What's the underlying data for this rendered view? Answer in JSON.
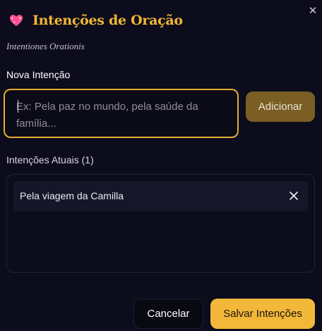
{
  "dialog": {
    "title": "Intenções de Oração",
    "subtitle": "Intentiones Orationis",
    "icon": "sparkling-heart-icon",
    "close_icon": "close-icon"
  },
  "new_intention": {
    "label": "Nova Intenção",
    "value": "",
    "placeholder": "Ex: Pela paz no mundo, pela saúde da família...",
    "add_label": "Adicionar"
  },
  "current": {
    "label": "Intenções Atuais (1)",
    "items": [
      {
        "text": "Pela viagem da Camilla"
      }
    ]
  },
  "footer": {
    "cancel_label": "Cancelar",
    "save_label": "Salvar Intenções"
  },
  "colors": {
    "background": "#0c0c1c",
    "accent": "#f2b733",
    "add_button": "#7a5e24",
    "input_border": "#e6ac2e"
  }
}
